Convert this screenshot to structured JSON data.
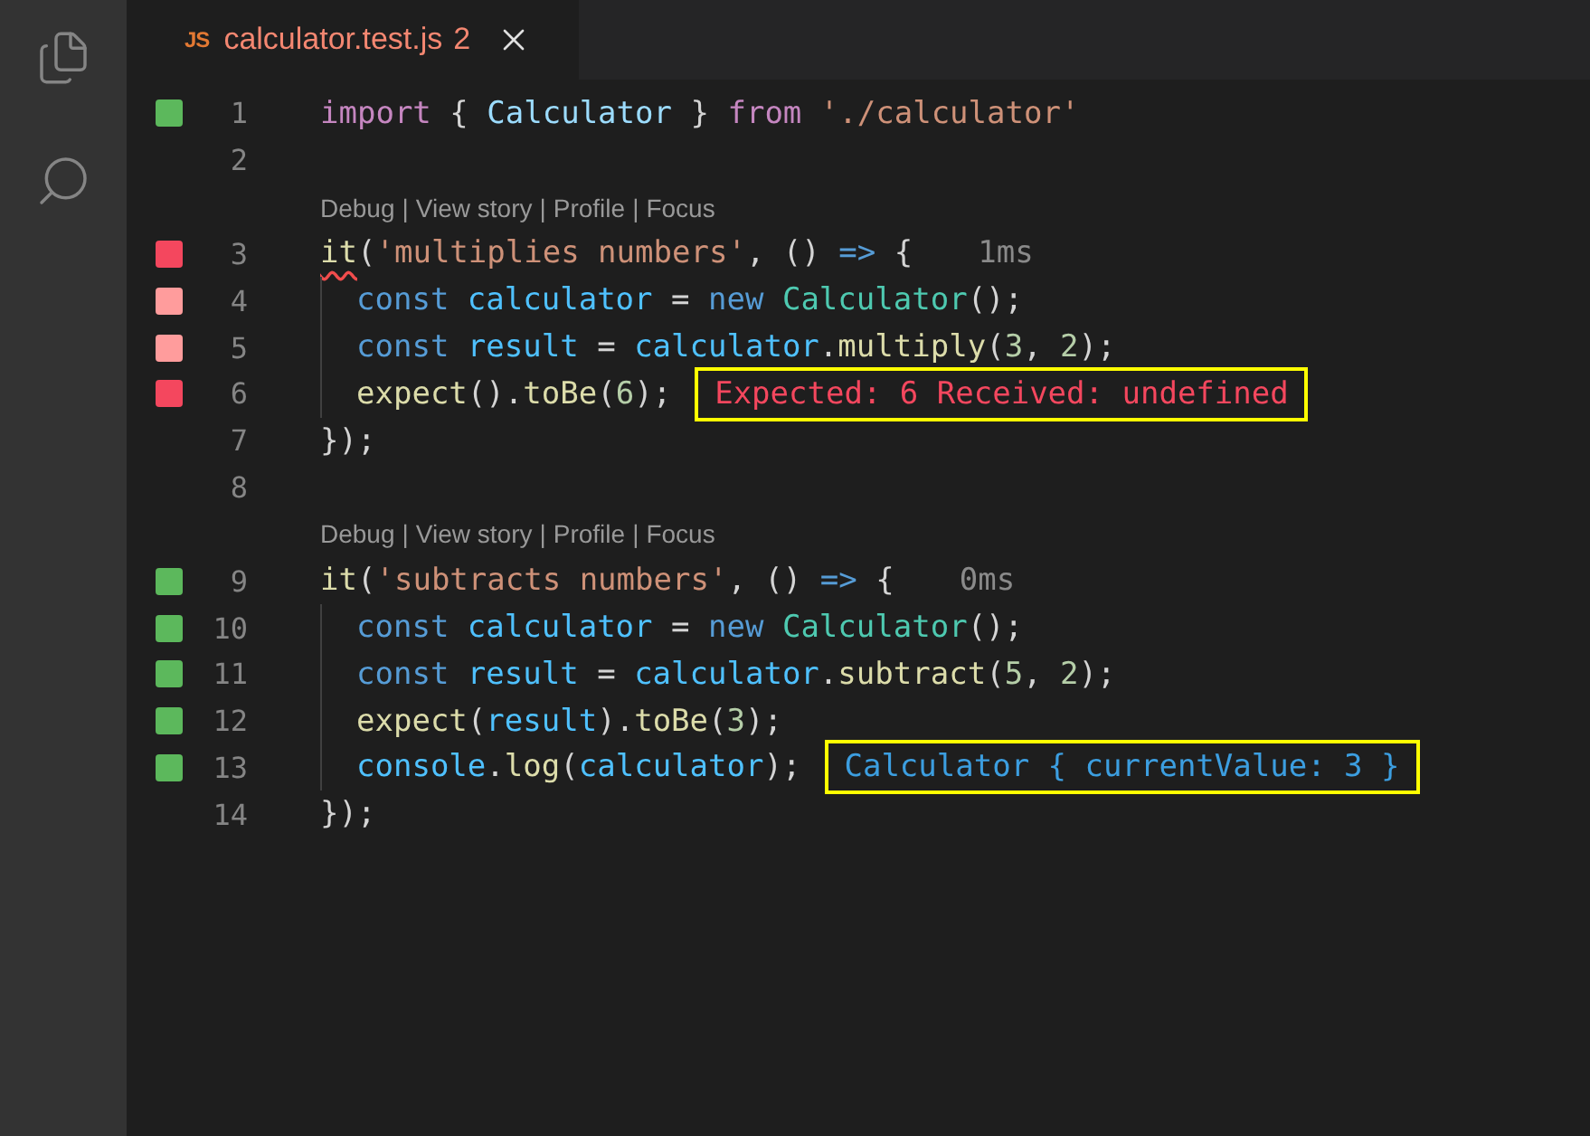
{
  "tab": {
    "icon_text": "JS",
    "filename": "calculator.test.js",
    "problem_count": "2",
    "selected": true
  },
  "lines": [
    {
      "number": "1",
      "color": "#5cb85c",
      "tokens": [
        {
          "text": "import ",
          "kind": "keyword"
        },
        {
          "text": "{ ",
          "kind": "punct"
        },
        {
          "text": "Calculator",
          "kind": "variable"
        },
        {
          "text": " } ",
          "kind": "punct"
        },
        {
          "text": "from ",
          "kind": "keyword"
        },
        {
          "text": "'./calculator'",
          "kind": "string"
        }
      ]
    },
    {
      "number": "2"
    },
    {
      "number": "3",
      "color": "#f4475e",
      "codelens": {
        "links": [
          "Debug",
          "View story",
          "Profile",
          "Focus"
        ],
        "separator": "|"
      },
      "duration": "1ms",
      "tokens": [
        {
          "text": "it",
          "kind": "function",
          "squiggle": true
        },
        {
          "text": "(",
          "kind": "punct"
        },
        {
          "text": "'multiplies numbers'",
          "kind": "string"
        },
        {
          "text": ", () ",
          "kind": "punct"
        },
        {
          "text": "=>",
          "kind": "storage"
        },
        {
          "text": " {",
          "kind": "punct"
        }
      ]
    },
    {
      "number": "4",
      "color": "#ff9c9c",
      "indent": true,
      "tokens": [
        {
          "text": "const ",
          "kind": "storage"
        },
        {
          "text": "calculator",
          "kind": "constant"
        },
        {
          "text": " = ",
          "kind": "punct"
        },
        {
          "text": "new ",
          "kind": "storage"
        },
        {
          "text": "Calculator",
          "kind": "class"
        },
        {
          "text": "();",
          "kind": "punct"
        }
      ]
    },
    {
      "number": "5",
      "color": "#ff9c9c",
      "indent": true,
      "tokens": [
        {
          "text": "const ",
          "kind": "storage"
        },
        {
          "text": "result",
          "kind": "constant"
        },
        {
          "text": " = ",
          "kind": "punct"
        },
        {
          "text": "calculator",
          "kind": "constant"
        },
        {
          "text": ".",
          "kind": "punct"
        },
        {
          "text": "multiply",
          "kind": "function"
        },
        {
          "text": "(",
          "kind": "punct"
        },
        {
          "text": "3",
          "kind": "number"
        },
        {
          "text": ", ",
          "kind": "punct"
        },
        {
          "text": "2",
          "kind": "number"
        },
        {
          "text": ");",
          "kind": "punct"
        }
      ]
    },
    {
      "number": "6",
      "color": "#f4475e",
      "indent": true,
      "annotation": {
        "kind": "error",
        "text": "Expected: 6 Received: undefined"
      },
      "tokens": [
        {
          "text": "expect",
          "kind": "function"
        },
        {
          "text": "().",
          "kind": "punct"
        },
        {
          "text": "toBe",
          "kind": "function"
        },
        {
          "text": "(",
          "kind": "punct"
        },
        {
          "text": "6",
          "kind": "number"
        },
        {
          "text": ");",
          "kind": "punct"
        }
      ]
    },
    {
      "number": "7",
      "tokens": [
        {
          "text": "});",
          "kind": "punct"
        }
      ]
    },
    {
      "number": "8"
    },
    {
      "number": "9",
      "color": "#5cb85c",
      "codelens": {
        "links": [
          "Debug",
          "View story",
          "Profile",
          "Focus"
        ],
        "separator": "|"
      },
      "duration": "0ms",
      "tokens": [
        {
          "text": "it",
          "kind": "function"
        },
        {
          "text": "(",
          "kind": "punct"
        },
        {
          "text": "'subtracts numbers'",
          "kind": "string"
        },
        {
          "text": ", () ",
          "kind": "punct"
        },
        {
          "text": "=>",
          "kind": "storage"
        },
        {
          "text": " {",
          "kind": "punct"
        }
      ]
    },
    {
      "number": "10",
      "color": "#5cb85c",
      "indent": true,
      "tokens": [
        {
          "text": "const ",
          "kind": "storage"
        },
        {
          "text": "calculator",
          "kind": "constant"
        },
        {
          "text": " = ",
          "kind": "punct"
        },
        {
          "text": "new ",
          "kind": "storage"
        },
        {
          "text": "Calculator",
          "kind": "class"
        },
        {
          "text": "();",
          "kind": "punct"
        }
      ]
    },
    {
      "number": "11",
      "color": "#5cb85c",
      "indent": true,
      "tokens": [
        {
          "text": "const ",
          "kind": "storage"
        },
        {
          "text": "result",
          "kind": "constant"
        },
        {
          "text": " = ",
          "kind": "punct"
        },
        {
          "text": "calculator",
          "kind": "constant"
        },
        {
          "text": ".",
          "kind": "punct"
        },
        {
          "text": "subtract",
          "kind": "function"
        },
        {
          "text": "(",
          "kind": "punct"
        },
        {
          "text": "5",
          "kind": "number"
        },
        {
          "text": ", ",
          "kind": "punct"
        },
        {
          "text": "2",
          "kind": "number"
        },
        {
          "text": ");",
          "kind": "punct"
        }
      ]
    },
    {
      "number": "12",
      "color": "#5cb85c",
      "indent": true,
      "tokens": [
        {
          "text": "expect",
          "kind": "function"
        },
        {
          "text": "(",
          "kind": "punct"
        },
        {
          "text": "result",
          "kind": "constant"
        },
        {
          "text": ").",
          "kind": "punct"
        },
        {
          "text": "toBe",
          "kind": "function"
        },
        {
          "text": "(",
          "kind": "punct"
        },
        {
          "text": "3",
          "kind": "number"
        },
        {
          "text": ");",
          "kind": "punct"
        }
      ]
    },
    {
      "number": "13",
      "color": "#5cb85c",
      "indent": true,
      "annotation": {
        "kind": "log",
        "text": "Calculator { currentValue: 3 }"
      },
      "tokens": [
        {
          "text": "console",
          "kind": "constant"
        },
        {
          "text": ".",
          "kind": "punct"
        },
        {
          "text": "log",
          "kind": "function"
        },
        {
          "text": "(",
          "kind": "punct"
        },
        {
          "text": "calculator",
          "kind": "constant"
        },
        {
          "text": ");",
          "kind": "punct"
        }
      ]
    },
    {
      "number": "14",
      "tokens": [
        {
          "text": "});",
          "kind": "punct"
        }
      ]
    }
  ]
}
